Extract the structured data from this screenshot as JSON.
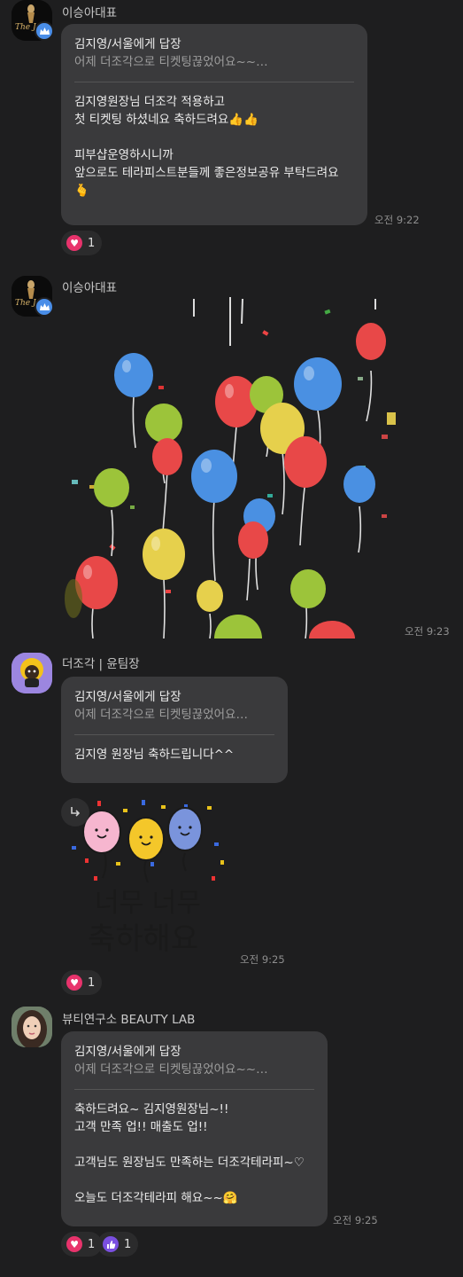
{
  "messages": [
    {
      "sender": "이승아대표",
      "reply_to": "김지영/서울에게 답장",
      "quote": "어제 더조각으로 티켓팅끊었어요~~…",
      "lines": [
        "김지영원장님 더조각 적용하고",
        "첫 티켓팅 하셨네요 축하드려요👍👍",
        "",
        "피부샵운영하시니까",
        "앞으로도 테라피스트분들께 좋은정보공유 부탁드려요",
        "🫰"
      ],
      "time": "오전 9:22",
      "reactions": [
        {
          "icon": "heart",
          "count": "1"
        }
      ]
    },
    {
      "sender": "이승아대표",
      "time": "오전 9:23",
      "image": "balloons"
    },
    {
      "sender": "더조각 | 윤팀장",
      "reply_to": "김지영/서울에게 답장",
      "quote": "어제 더조각으로 티켓팅끊었어요…",
      "lines": [
        "김지영 원장님 축하드립니다^^"
      ],
      "sticker_text_1": "너무 너무",
      "sticker_text_2": "축하해요",
      "time": "오전 9:25",
      "reactions": [
        {
          "icon": "heart",
          "count": "1"
        }
      ]
    },
    {
      "sender": "뷰티연구소 BEAUTY LAB",
      "reply_to": "김지영/서울에게 답장",
      "quote": "어제 더조각으로 티켓팅끊었어요~~…",
      "lines": [
        "축하드려요~ 김지영원장님~!!",
        "고객 만족 업!! 매출도 업!!",
        "",
        "고객님도 원장님도 만족하는 더조각테라피~♡",
        "",
        "오늘도 더조각테라피 해요~~🤗"
      ],
      "time": "오전 9:25",
      "reactions": [
        {
          "icon": "heart",
          "count": "1"
        },
        {
          "icon": "thumbs-up",
          "count": "1"
        }
      ]
    }
  ],
  "avatar_logo_text": "The Jo",
  "colors": {
    "background": "#1e1e1f",
    "bubble": "#3a3a3c",
    "heart": "#e8336c",
    "thumb": "#7a4fe0",
    "badge": "#4a8ee8"
  }
}
